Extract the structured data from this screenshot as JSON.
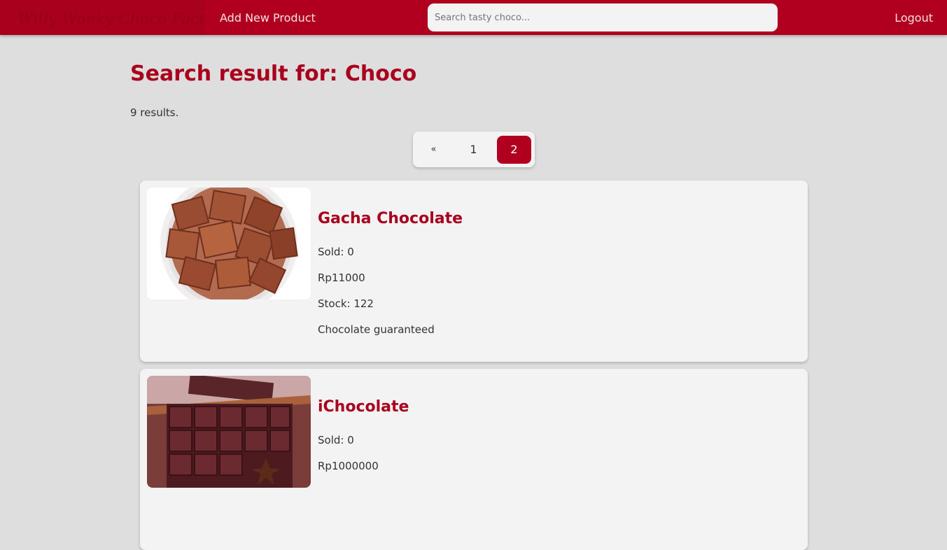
{
  "header": {
    "brand": "Willy Wonky Choco Factory",
    "add_product": "Add New Product",
    "search_placeholder": "Search tasty choco...",
    "logout": "Logout"
  },
  "main": {
    "title": "Search result for: Choco",
    "result_count": "9 results."
  },
  "pagination": {
    "prev": "«",
    "pages": [
      "1",
      "2"
    ],
    "current": "2"
  },
  "products": [
    {
      "name": "Gacha Chocolate",
      "sold": "Sold: 0",
      "price": "Rp11000",
      "stock": "Stock: 122",
      "description": "Chocolate guaranteed"
    },
    {
      "name": "iChocolate",
      "sold": "Sold: 0",
      "price": "Rp1000000",
      "stock": "",
      "description": ""
    }
  ],
  "colors": {
    "primary": "#b1001f",
    "background": "#dedede",
    "card": "#f3f3f3"
  }
}
